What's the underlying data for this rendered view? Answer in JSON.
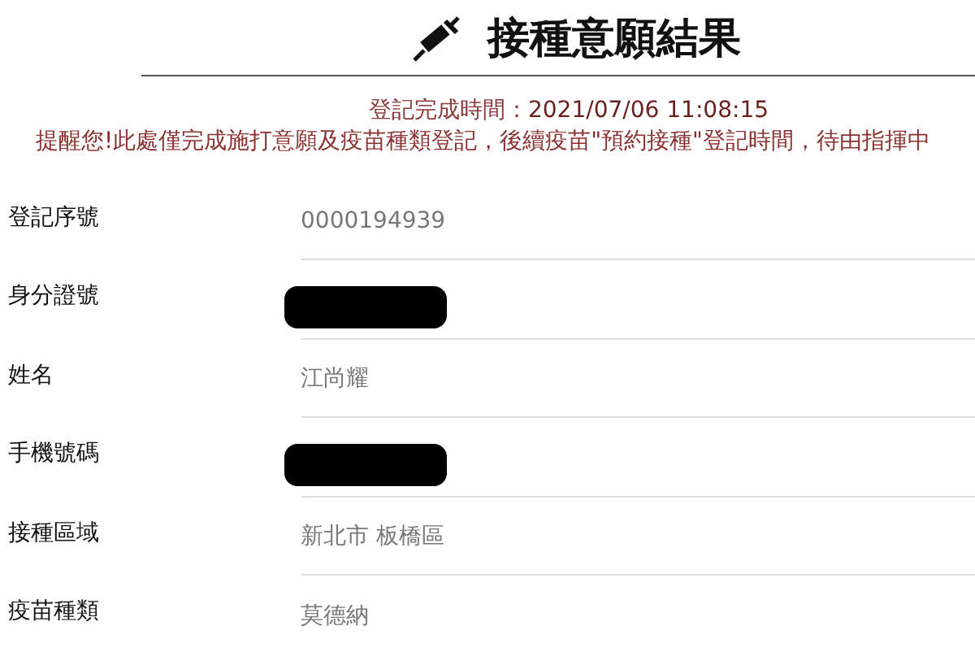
{
  "title": "接種意願結果",
  "completion": {
    "label": "登記完成時間：",
    "time": "2021/07/06 11:08:15"
  },
  "reminder": "提醒您!此處僅完成施打意願及疫苗種類登記，後續疫苗\"預約接種\"登記時間，待由指揮中",
  "fields": [
    {
      "label": "登記序號",
      "value": "0000194939",
      "redacted": false
    },
    {
      "label": "身分證號",
      "redacted": true
    },
    {
      "label": "姓名",
      "value": "江尚耀",
      "redacted": false
    },
    {
      "label": "手機號碼",
      "redacted": true
    },
    {
      "label": "接種區域",
      "value": "新北市 板橋區",
      "redacted": false
    },
    {
      "label": "疫苗種類",
      "value": "莫德納",
      "redacted": false
    }
  ]
}
